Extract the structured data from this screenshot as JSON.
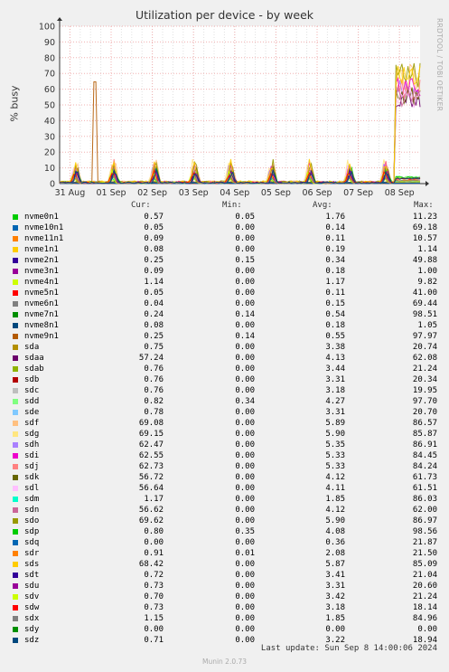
{
  "chart_data": {
    "type": "line",
    "title": "Utilization per device - by week",
    "ylabel": "% busy",
    "ylim": [
      0,
      100
    ],
    "yticks": [
      0,
      10,
      20,
      30,
      40,
      50,
      60,
      70,
      80,
      90,
      100
    ],
    "xticks": [
      "31 Aug",
      "01 Sep",
      "02 Sep",
      "03 Sep",
      "04 Sep",
      "05 Sep",
      "06 Sep",
      "07 Sep",
      "08 Sep"
    ],
    "legend_headers": {
      "cur": "Cur:",
      "min": "Min:",
      "avg": "Avg:",
      "max": "Max:"
    },
    "series": [
      {
        "name": "nvme0n1",
        "color": "#00cc00",
        "cur": "0.57",
        "min": "0.05",
        "avg": "1.76",
        "max": "11.23"
      },
      {
        "name": "nvme10n1",
        "color": "#0066b3",
        "cur": "0.05",
        "min": "0.00",
        "avg": "0.14",
        "max": "69.18"
      },
      {
        "name": "nvme11n1",
        "color": "#ff8000",
        "cur": "0.09",
        "min": "0.00",
        "avg": "0.11",
        "max": "10.57"
      },
      {
        "name": "nvme1n1",
        "color": "#ffcc00",
        "cur": "0.08",
        "min": "0.00",
        "avg": "0.19",
        "max": "1.14"
      },
      {
        "name": "nvme2n1",
        "color": "#330099",
        "cur": "0.25",
        "min": "0.15",
        "avg": "0.34",
        "max": "49.88"
      },
      {
        "name": "nvme3n1",
        "color": "#990099",
        "cur": "0.09",
        "min": "0.00",
        "avg": "0.18",
        "max": "1.00"
      },
      {
        "name": "nvme4n1",
        "color": "#ccff00",
        "cur": "1.14",
        "min": "0.00",
        "avg": "1.17",
        "max": "9.82"
      },
      {
        "name": "nvme5n1",
        "color": "#ff0000",
        "cur": "0.05",
        "min": "0.00",
        "avg": "0.11",
        "max": "41.00"
      },
      {
        "name": "nvme6n1",
        "color": "#808080",
        "cur": "0.04",
        "min": "0.00",
        "avg": "0.15",
        "max": "69.44"
      },
      {
        "name": "nvme7n1",
        "color": "#008f00",
        "cur": "0.24",
        "min": "0.14",
        "avg": "0.54",
        "max": "98.51"
      },
      {
        "name": "nvme8n1",
        "color": "#00487d",
        "cur": "0.08",
        "min": "0.00",
        "avg": "0.18",
        "max": "1.05"
      },
      {
        "name": "nvme9n1",
        "color": "#b35a00",
        "cur": "0.25",
        "min": "0.14",
        "avg": "0.55",
        "max": "97.97"
      },
      {
        "name": "sda",
        "color": "#b38f00",
        "cur": "0.75",
        "min": "0.00",
        "avg": "3.38",
        "max": "20.74"
      },
      {
        "name": "sdaa",
        "color": "#6b006b",
        "cur": "57.24",
        "min": "0.00",
        "avg": "4.13",
        "max": "62.08"
      },
      {
        "name": "sdab",
        "color": "#8fb300",
        "cur": "0.76",
        "min": "0.00",
        "avg": "3.44",
        "max": "21.24"
      },
      {
        "name": "sdb",
        "color": "#b30000",
        "cur": "0.76",
        "min": "0.00",
        "avg": "3.31",
        "max": "20.34"
      },
      {
        "name": "sdc",
        "color": "#bebebe",
        "cur": "0.76",
        "min": "0.00",
        "avg": "3.18",
        "max": "19.95"
      },
      {
        "name": "sdd",
        "color": "#80ff80",
        "cur": "0.82",
        "min": "0.34",
        "avg": "4.27",
        "max": "97.70"
      },
      {
        "name": "sde",
        "color": "#80c9ff",
        "cur": "0.78",
        "min": "0.00",
        "avg": "3.31",
        "max": "20.70"
      },
      {
        "name": "sdf",
        "color": "#ffc080",
        "cur": "69.08",
        "min": "0.00",
        "avg": "5.89",
        "max": "86.57"
      },
      {
        "name": "sdg",
        "color": "#ffe680",
        "cur": "69.15",
        "min": "0.00",
        "avg": "5.90",
        "max": "85.87"
      },
      {
        "name": "sdh",
        "color": "#aa80ff",
        "cur": "62.47",
        "min": "0.00",
        "avg": "5.35",
        "max": "86.91"
      },
      {
        "name": "sdi",
        "color": "#ee00cc",
        "cur": "62.55",
        "min": "0.00",
        "avg": "5.33",
        "max": "84.45"
      },
      {
        "name": "sdj",
        "color": "#ff8080",
        "cur": "62.73",
        "min": "0.00",
        "avg": "5.33",
        "max": "84.24"
      },
      {
        "name": "sdk",
        "color": "#666600",
        "cur": "56.72",
        "min": "0.00",
        "avg": "4.12",
        "max": "61.73"
      },
      {
        "name": "sdl",
        "color": "#ffbfff",
        "cur": "56.64",
        "min": "0.00",
        "avg": "4.11",
        "max": "61.51"
      },
      {
        "name": "sdm",
        "color": "#00ffcc",
        "cur": "1.17",
        "min": "0.00",
        "avg": "1.85",
        "max": "86.03"
      },
      {
        "name": "sdn",
        "color": "#cc6699",
        "cur": "56.62",
        "min": "0.00",
        "avg": "4.12",
        "max": "62.00"
      },
      {
        "name": "sdo",
        "color": "#999900",
        "cur": "69.62",
        "min": "0.00",
        "avg": "5.90",
        "max": "86.97"
      },
      {
        "name": "sdp",
        "color": "#00cc00",
        "cur": "0.80",
        "min": "0.35",
        "avg": "4.08",
        "max": "98.56"
      },
      {
        "name": "sdq",
        "color": "#0066b3",
        "cur": "0.00",
        "min": "0.00",
        "avg": "0.36",
        "max": "21.87"
      },
      {
        "name": "sdr",
        "color": "#ff8000",
        "cur": "0.91",
        "min": "0.01",
        "avg": "2.08",
        "max": "21.50"
      },
      {
        "name": "sds",
        "color": "#ffcc00",
        "cur": "68.42",
        "min": "0.00",
        "avg": "5.87",
        "max": "85.09"
      },
      {
        "name": "sdt",
        "color": "#330099",
        "cur": "0.72",
        "min": "0.00",
        "avg": "3.41",
        "max": "21.04"
      },
      {
        "name": "sdu",
        "color": "#990099",
        "cur": "0.73",
        "min": "0.00",
        "avg": "3.31",
        "max": "20.60"
      },
      {
        "name": "sdv",
        "color": "#ccff00",
        "cur": "0.70",
        "min": "0.00",
        "avg": "3.42",
        "max": "21.24"
      },
      {
        "name": "sdw",
        "color": "#ff0000",
        "cur": "0.73",
        "min": "0.00",
        "avg": "3.18",
        "max": "18.14"
      },
      {
        "name": "sdx",
        "color": "#808080",
        "cur": "1.15",
        "min": "0.00",
        "avg": "1.85",
        "max": "84.96"
      },
      {
        "name": "sdy",
        "color": "#008f00",
        "cur": "0.00",
        "min": "0.00",
        "avg": "0.00",
        "max": "0.00"
      },
      {
        "name": "sdz",
        "color": "#00487d",
        "cur": "0.71",
        "min": "0.00",
        "avg": "3.22",
        "max": "18.94"
      }
    ]
  },
  "footer": {
    "last_update": "Last update: Sun Sep  8 14:00:06 2024",
    "version": "Munin 2.0.73",
    "watermark": "RRDTOOL / TOBI OETIKER"
  }
}
